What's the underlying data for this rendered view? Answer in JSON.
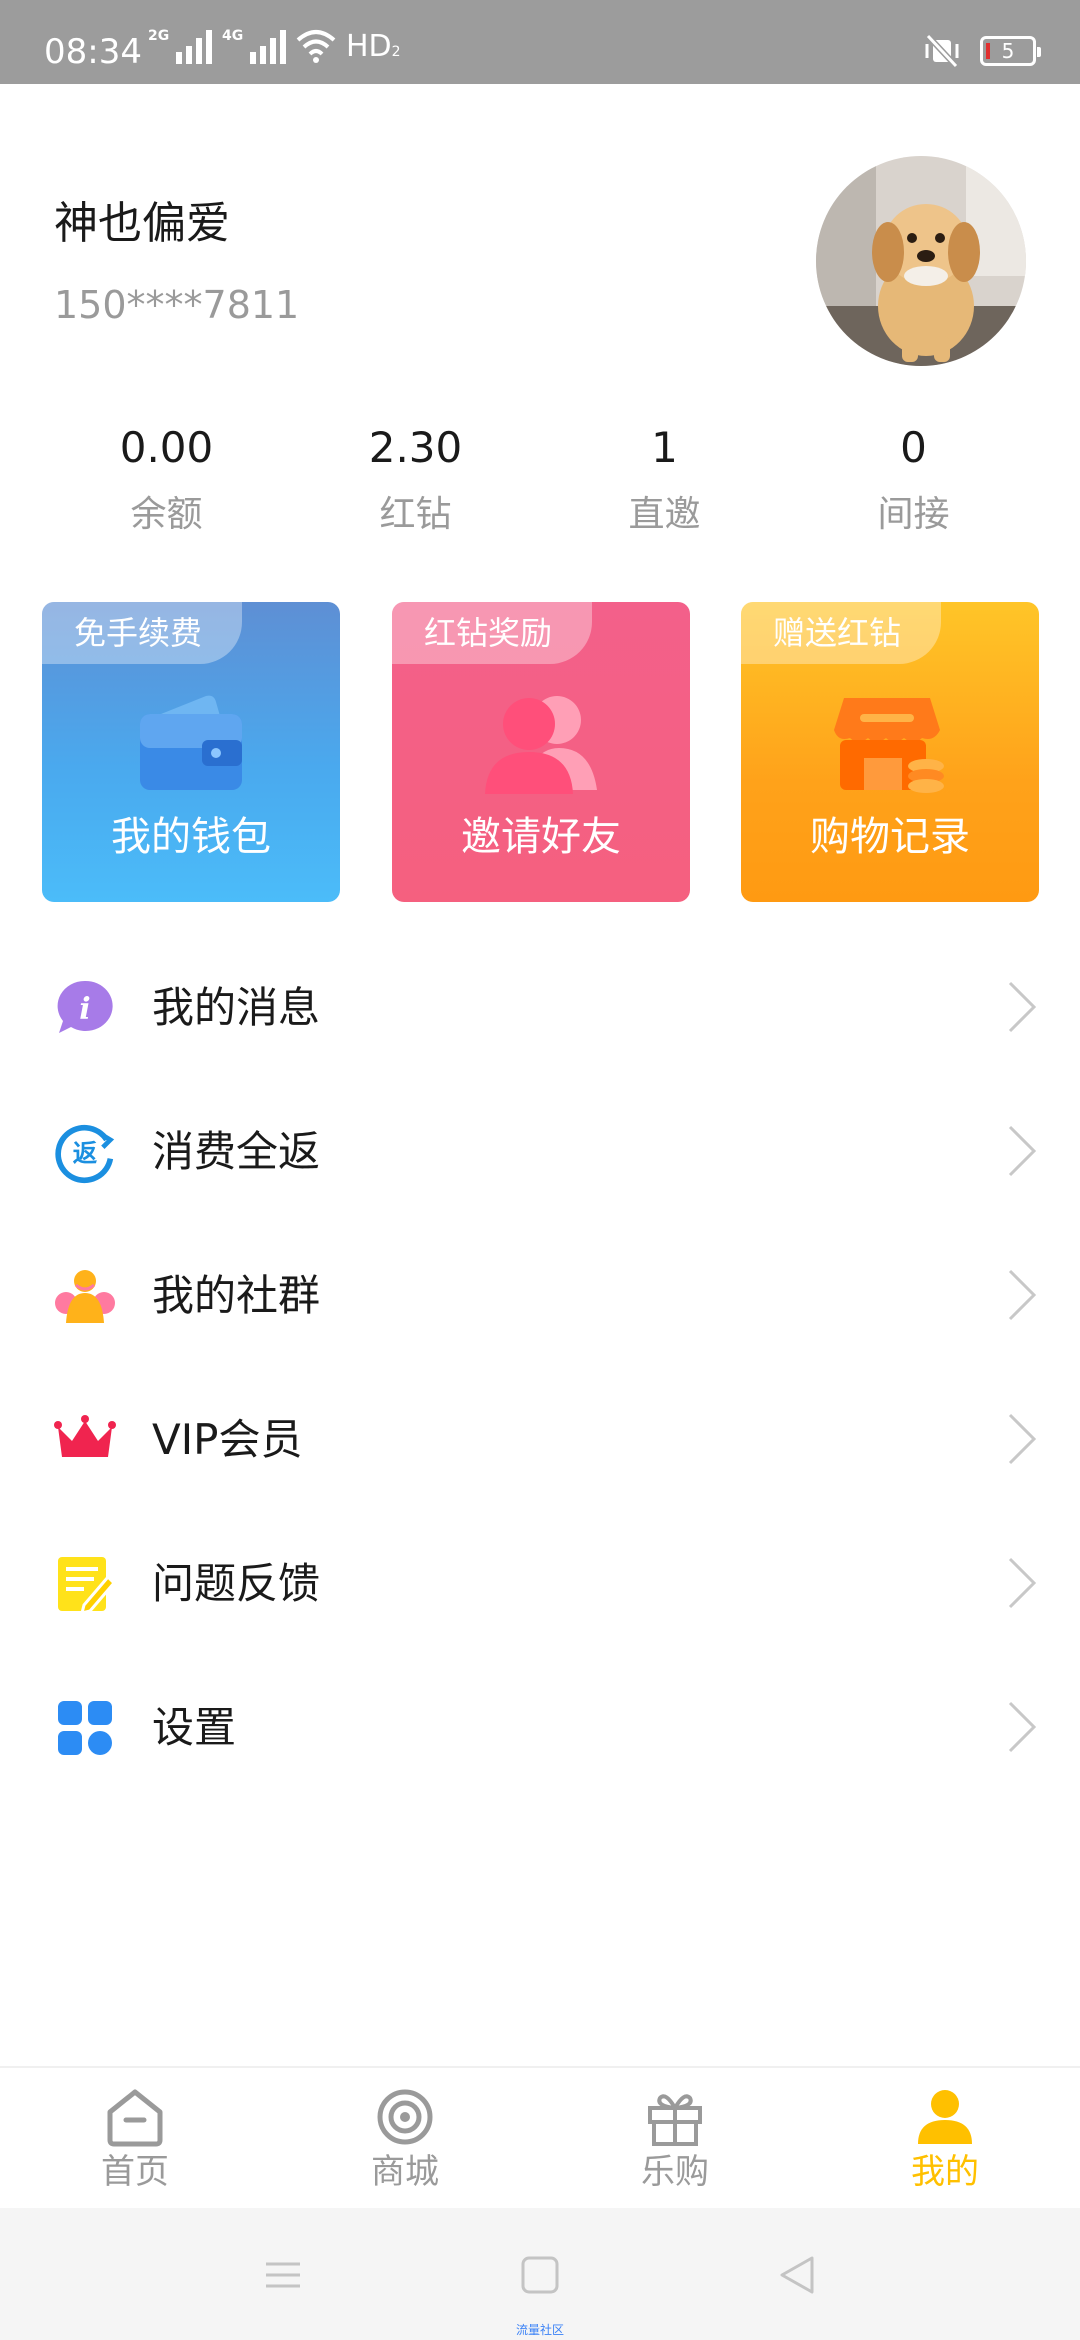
{
  "status_bar": {
    "time": "08:34",
    "signal1_gen": "2G",
    "signal2_gen": "4G",
    "hd_label": "HD",
    "hd_sub": "2",
    "battery_level": "5"
  },
  "profile": {
    "name": "神也偏爱",
    "phone": "150****7811"
  },
  "stats": [
    {
      "value": "0.00",
      "label": "余额"
    },
    {
      "value": "2.30",
      "label": "红钻"
    },
    {
      "value": "1",
      "label": "直邀"
    },
    {
      "value": "0",
      "label": "间接"
    }
  ],
  "cards": [
    {
      "tag": "免手续费",
      "title": "我的钱包",
      "icon": "wallet-icon"
    },
    {
      "tag": "红钻奖励",
      "title": "邀请好友",
      "icon": "friends-icon"
    },
    {
      "tag": "赠送红钻",
      "title": "购物记录",
      "icon": "shop-icon"
    }
  ],
  "menu": [
    {
      "label": "我的消息",
      "icon": "info-icon"
    },
    {
      "label": "消费全返",
      "icon": "rebate-icon"
    },
    {
      "label": "我的社群",
      "icon": "community-icon"
    },
    {
      "label": "VIP会员",
      "icon": "crown-icon"
    },
    {
      "label": "问题反馈",
      "icon": "feedback-icon"
    },
    {
      "label": "设置",
      "icon": "settings-icon"
    }
  ],
  "bottom_nav": [
    {
      "label": "首页",
      "icon": "home-icon",
      "active": false
    },
    {
      "label": "商城",
      "icon": "mall-icon",
      "active": false
    },
    {
      "label": "乐购",
      "icon": "gift-icon",
      "active": false
    },
    {
      "label": "我的",
      "icon": "user-icon",
      "active": true
    }
  ],
  "system_bar": {
    "caption": "流量社区"
  },
  "colors": {
    "accent": "#ffc000",
    "muted_text": "#9a9a9a",
    "status_bar": "#9c9c9c"
  }
}
